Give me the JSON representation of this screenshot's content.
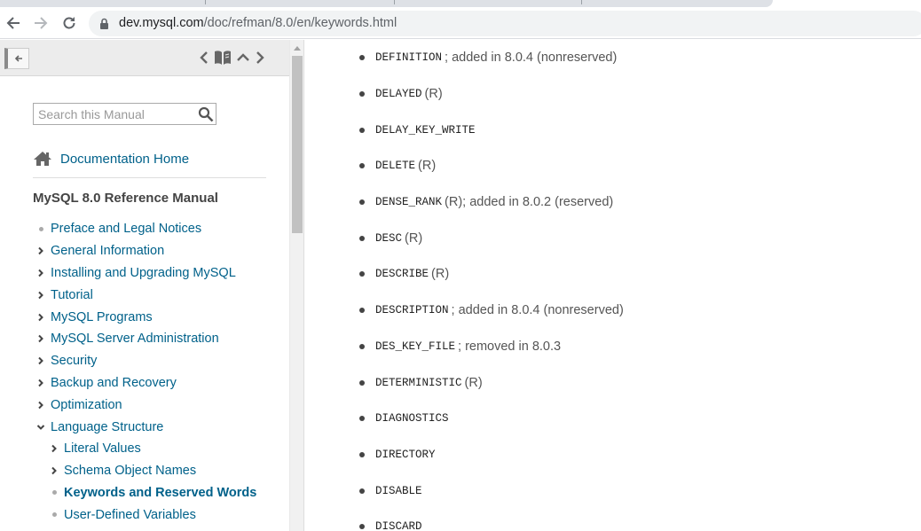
{
  "browser": {
    "url_host": "dev.mysql.com",
    "url_path": "/doc/refman/8.0/en/keywords.html"
  },
  "sidebar": {
    "search_placeholder": "Search this Manual",
    "doc_home": "Documentation Home",
    "manual_title": "MySQL 8.0 Reference Manual",
    "toc": [
      {
        "label": "Preface and Legal Notices",
        "marker": "dot"
      },
      {
        "label": "General Information",
        "marker": "chevron"
      },
      {
        "label": "Installing and Upgrading MySQL",
        "marker": "chevron"
      },
      {
        "label": "Tutorial",
        "marker": "chevron"
      },
      {
        "label": "MySQL Programs",
        "marker": "chevron"
      },
      {
        "label": "MySQL Server Administration",
        "marker": "chevron"
      },
      {
        "label": "Security",
        "marker": "chevron"
      },
      {
        "label": "Backup and Recovery",
        "marker": "chevron"
      },
      {
        "label": "Optimization",
        "marker": "chevron"
      },
      {
        "label": "Language Structure",
        "marker": "chevron-down"
      },
      {
        "label": "Literal Values",
        "marker": "chevron",
        "sub": true
      },
      {
        "label": "Schema Object Names",
        "marker": "chevron",
        "sub": true
      },
      {
        "label": "Keywords and Reserved Words",
        "marker": "dot",
        "sub": true,
        "active": true
      },
      {
        "label": "User-Defined Variables",
        "marker": "dot",
        "sub": true
      }
    ]
  },
  "keywords": [
    {
      "code": "DEFINITION",
      "note": "; added in 8.0.4 (nonreserved)"
    },
    {
      "code": "DELAYED",
      "note": " (R)"
    },
    {
      "code": "DELAY_KEY_WRITE",
      "note": ""
    },
    {
      "code": "DELETE",
      "note": " (R)"
    },
    {
      "code": "DENSE_RANK",
      "note": " (R); added in 8.0.2 (reserved)"
    },
    {
      "code": "DESC",
      "note": " (R)"
    },
    {
      "code": "DESCRIBE",
      "note": " (R)"
    },
    {
      "code": "DESCRIPTION",
      "note": "; added in 8.0.4 (nonreserved)"
    },
    {
      "code": "DES_KEY_FILE",
      "note": "; removed in 8.0.3"
    },
    {
      "code": "DETERMINISTIC",
      "note": " (R)"
    },
    {
      "code": "DIAGNOSTICS",
      "note": ""
    },
    {
      "code": "DIRECTORY",
      "note": ""
    },
    {
      "code": "DISABLE",
      "note": ""
    },
    {
      "code": "DISCARD",
      "note": ""
    }
  ],
  "colors": {
    "link": "#00618a",
    "text": "#444444"
  },
  "icons": {
    "back": "arrow-left-icon",
    "forward": "arrow-right-icon",
    "reload": "reload-icon",
    "lock": "lock-icon",
    "sidebar_back": "arrow-left-icon",
    "prev": "chevron-left-icon",
    "book": "book-icon",
    "up": "chevron-up-icon",
    "next": "chevron-right-icon",
    "search": "search-icon",
    "home": "home-icon"
  }
}
